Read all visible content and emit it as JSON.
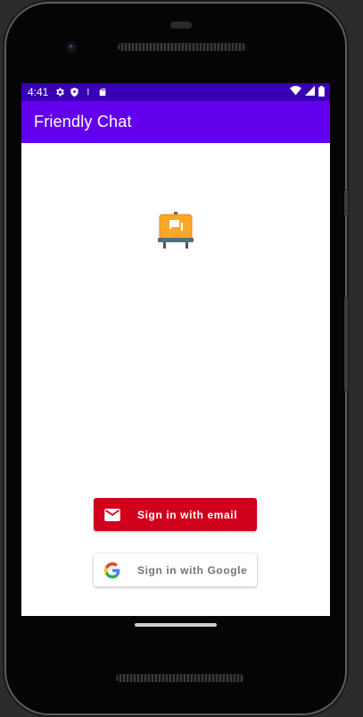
{
  "status_bar": {
    "time": "4:41",
    "left_icons": [
      "settings-icon",
      "shield-icon",
      "debug-icon",
      "sd-card-icon"
    ],
    "right_icons": [
      "wifi-icon",
      "signal-icon",
      "battery-icon"
    ],
    "color": "#3700b3"
  },
  "app_bar": {
    "title": "Friendly Chat",
    "color": "#6200ee"
  },
  "logo": {
    "icon": "chat-easel-icon"
  },
  "auth": {
    "email_button": {
      "label": "Sign in with email",
      "icon": "mail-icon",
      "color": "#d0021b"
    },
    "google_button": {
      "label": "Sign in with Google",
      "icon": "google-g-icon",
      "color": "#ffffff"
    }
  }
}
